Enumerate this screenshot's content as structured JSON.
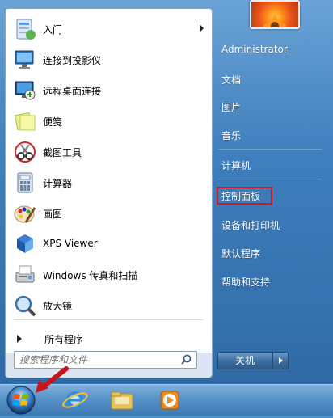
{
  "start_menu": {
    "programs": [
      {
        "label": "入门",
        "icon": "getting-started-icon",
        "has_submenu": true
      },
      {
        "label": "连接到投影仪",
        "icon": "projector-icon"
      },
      {
        "label": "远程桌面连接",
        "icon": "remote-desktop-icon"
      },
      {
        "label": "便笺",
        "icon": "sticky-notes-icon"
      },
      {
        "label": "截图工具",
        "icon": "snipping-tool-icon"
      },
      {
        "label": "计算器",
        "icon": "calculator-icon"
      },
      {
        "label": "画图",
        "icon": "paint-icon"
      },
      {
        "label": "XPS Viewer",
        "icon": "xps-viewer-icon"
      },
      {
        "label": "Windows 传真和扫描",
        "icon": "fax-scan-icon"
      },
      {
        "label": "放大镜",
        "icon": "magnifier-icon"
      }
    ],
    "all_programs": "所有程序",
    "search_placeholder": "搜索程序和文件",
    "right_items": [
      "Administrator",
      "文档",
      "图片",
      "音乐",
      "计算机",
      "控制面板",
      "设备和打印机",
      "默认程序",
      "帮助和支持"
    ],
    "shutdown_label": "关机",
    "highlighted_item": "控制面板"
  },
  "colors": {
    "highlight_box": "#d9141b",
    "annotation_arrow": "#c8151b"
  }
}
